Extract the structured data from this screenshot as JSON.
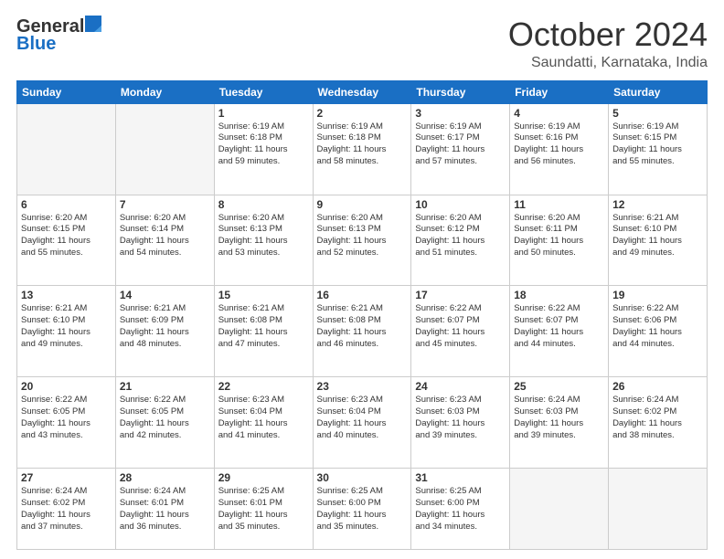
{
  "header": {
    "logo_line1": "General",
    "logo_line2": "Blue",
    "month": "October 2024",
    "location": "Saundatti, Karnataka, India"
  },
  "days_of_week": [
    "Sunday",
    "Monday",
    "Tuesday",
    "Wednesday",
    "Thursday",
    "Friday",
    "Saturday"
  ],
  "weeks": [
    [
      {
        "day": "",
        "info": ""
      },
      {
        "day": "",
        "info": ""
      },
      {
        "day": "1",
        "info": "Sunrise: 6:19 AM\nSunset: 6:18 PM\nDaylight: 11 hours\nand 59 minutes."
      },
      {
        "day": "2",
        "info": "Sunrise: 6:19 AM\nSunset: 6:18 PM\nDaylight: 11 hours\nand 58 minutes."
      },
      {
        "day": "3",
        "info": "Sunrise: 6:19 AM\nSunset: 6:17 PM\nDaylight: 11 hours\nand 57 minutes."
      },
      {
        "day": "4",
        "info": "Sunrise: 6:19 AM\nSunset: 6:16 PM\nDaylight: 11 hours\nand 56 minutes."
      },
      {
        "day": "5",
        "info": "Sunrise: 6:19 AM\nSunset: 6:15 PM\nDaylight: 11 hours\nand 55 minutes."
      }
    ],
    [
      {
        "day": "6",
        "info": "Sunrise: 6:20 AM\nSunset: 6:15 PM\nDaylight: 11 hours\nand 55 minutes."
      },
      {
        "day": "7",
        "info": "Sunrise: 6:20 AM\nSunset: 6:14 PM\nDaylight: 11 hours\nand 54 minutes."
      },
      {
        "day": "8",
        "info": "Sunrise: 6:20 AM\nSunset: 6:13 PM\nDaylight: 11 hours\nand 53 minutes."
      },
      {
        "day": "9",
        "info": "Sunrise: 6:20 AM\nSunset: 6:13 PM\nDaylight: 11 hours\nand 52 minutes."
      },
      {
        "day": "10",
        "info": "Sunrise: 6:20 AM\nSunset: 6:12 PM\nDaylight: 11 hours\nand 51 minutes."
      },
      {
        "day": "11",
        "info": "Sunrise: 6:20 AM\nSunset: 6:11 PM\nDaylight: 11 hours\nand 50 minutes."
      },
      {
        "day": "12",
        "info": "Sunrise: 6:21 AM\nSunset: 6:10 PM\nDaylight: 11 hours\nand 49 minutes."
      }
    ],
    [
      {
        "day": "13",
        "info": "Sunrise: 6:21 AM\nSunset: 6:10 PM\nDaylight: 11 hours\nand 49 minutes."
      },
      {
        "day": "14",
        "info": "Sunrise: 6:21 AM\nSunset: 6:09 PM\nDaylight: 11 hours\nand 48 minutes."
      },
      {
        "day": "15",
        "info": "Sunrise: 6:21 AM\nSunset: 6:08 PM\nDaylight: 11 hours\nand 47 minutes."
      },
      {
        "day": "16",
        "info": "Sunrise: 6:21 AM\nSunset: 6:08 PM\nDaylight: 11 hours\nand 46 minutes."
      },
      {
        "day": "17",
        "info": "Sunrise: 6:22 AM\nSunset: 6:07 PM\nDaylight: 11 hours\nand 45 minutes."
      },
      {
        "day": "18",
        "info": "Sunrise: 6:22 AM\nSunset: 6:07 PM\nDaylight: 11 hours\nand 44 minutes."
      },
      {
        "day": "19",
        "info": "Sunrise: 6:22 AM\nSunset: 6:06 PM\nDaylight: 11 hours\nand 44 minutes."
      }
    ],
    [
      {
        "day": "20",
        "info": "Sunrise: 6:22 AM\nSunset: 6:05 PM\nDaylight: 11 hours\nand 43 minutes."
      },
      {
        "day": "21",
        "info": "Sunrise: 6:22 AM\nSunset: 6:05 PM\nDaylight: 11 hours\nand 42 minutes."
      },
      {
        "day": "22",
        "info": "Sunrise: 6:23 AM\nSunset: 6:04 PM\nDaylight: 11 hours\nand 41 minutes."
      },
      {
        "day": "23",
        "info": "Sunrise: 6:23 AM\nSunset: 6:04 PM\nDaylight: 11 hours\nand 40 minutes."
      },
      {
        "day": "24",
        "info": "Sunrise: 6:23 AM\nSunset: 6:03 PM\nDaylight: 11 hours\nand 39 minutes."
      },
      {
        "day": "25",
        "info": "Sunrise: 6:24 AM\nSunset: 6:03 PM\nDaylight: 11 hours\nand 39 minutes."
      },
      {
        "day": "26",
        "info": "Sunrise: 6:24 AM\nSunset: 6:02 PM\nDaylight: 11 hours\nand 38 minutes."
      }
    ],
    [
      {
        "day": "27",
        "info": "Sunrise: 6:24 AM\nSunset: 6:02 PM\nDaylight: 11 hours\nand 37 minutes."
      },
      {
        "day": "28",
        "info": "Sunrise: 6:24 AM\nSunset: 6:01 PM\nDaylight: 11 hours\nand 36 minutes."
      },
      {
        "day": "29",
        "info": "Sunrise: 6:25 AM\nSunset: 6:01 PM\nDaylight: 11 hours\nand 35 minutes."
      },
      {
        "day": "30",
        "info": "Sunrise: 6:25 AM\nSunset: 6:00 PM\nDaylight: 11 hours\nand 35 minutes."
      },
      {
        "day": "31",
        "info": "Sunrise: 6:25 AM\nSunset: 6:00 PM\nDaylight: 11 hours\nand 34 minutes."
      },
      {
        "day": "",
        "info": ""
      },
      {
        "day": "",
        "info": ""
      }
    ]
  ]
}
